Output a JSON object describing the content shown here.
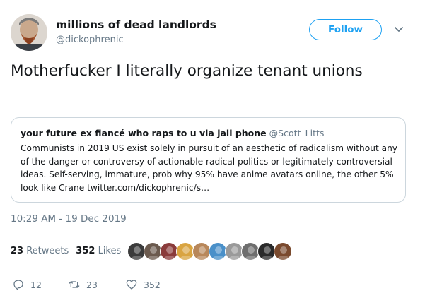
{
  "author": {
    "name": "millions of dead landlords",
    "handle": "@dickophrenic",
    "avatar_icon": "avatar-bearded-man-icon"
  },
  "follow_label": "Follow",
  "tweet_text": "Motherfucker I literally organize tenant unions",
  "quote": {
    "name": "your future ex fiancé who raps to u via jail phone",
    "handle": "@Scott_Litts_",
    "text": "Communists in 2019 US exist solely in pursuit of an aesthetic of radicalism without any of the danger or controversy of actionable radical politics or legitimately controversial ideas. Self-serving, immature, prob why 95% have anime avatars online, the other 5% look like Crane twitter.com/dickophrenic/s…"
  },
  "timestamp": "10:29 AM - 19 Dec 2019",
  "stats": {
    "retweets_count": "23",
    "retweets_label": "Retweets",
    "likes_count": "352",
    "likes_label": "Likes"
  },
  "liker_avatars": [
    {
      "icon": "liker-avatar-icon",
      "color": "#3b3b3b"
    },
    {
      "icon": "liker-avatar-icon",
      "color": "#6b5a4e"
    },
    {
      "icon": "liker-avatar-icon",
      "color": "#8a3b3b"
    },
    {
      "icon": "liker-avatar-icon",
      "color": "#d9a441"
    },
    {
      "icon": "liker-avatar-icon",
      "color": "#b8875a"
    },
    {
      "icon": "liker-avatar-icon",
      "color": "#4a90c9"
    },
    {
      "icon": "liker-avatar-icon",
      "color": "#9a9a9a"
    },
    {
      "icon": "liker-avatar-icon",
      "color": "#6e6e6e"
    },
    {
      "icon": "liker-avatar-icon",
      "color": "#2a2a2a"
    },
    {
      "icon": "liker-avatar-icon",
      "color": "#7a4a2e"
    }
  ],
  "actions": {
    "replies": "12",
    "retweets": "23",
    "likes": "352"
  },
  "colors": {
    "accent": "#1da1f2",
    "muted": "#657786",
    "border": "#ccd6dd"
  }
}
